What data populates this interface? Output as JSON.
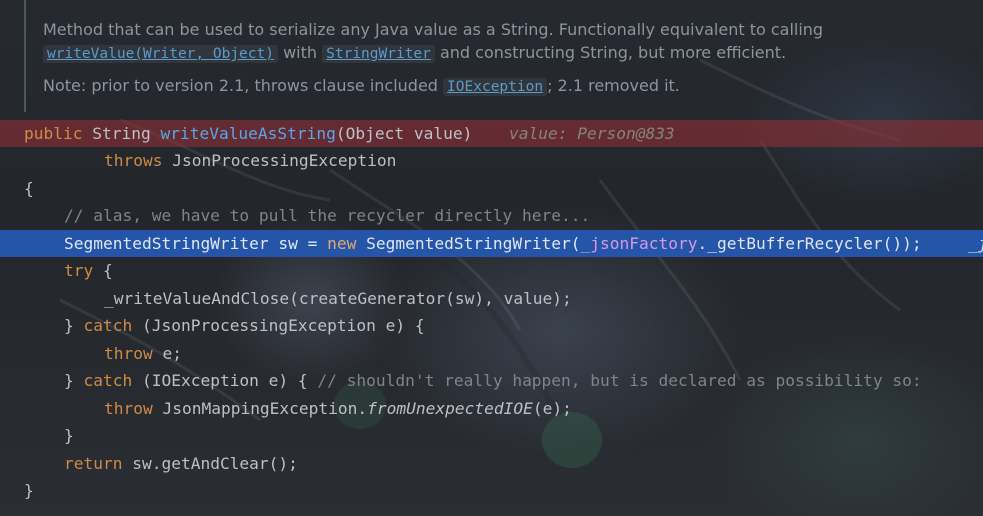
{
  "doc": {
    "line1": "Method that can be used to serialize any Java value as a String. Functionally equivalent to calling",
    "link_writevalue": "writeValue(Writer, Object)",
    "with": "with",
    "link_stringwriter": "StringWriter",
    "line2_rest": "and constructing String, but more efficient.",
    "note_prefix": "Note: prior to version 2.1, throws clause included",
    "link_ioexception": "IOException",
    "note_suffix": "; 2.1 removed it."
  },
  "code": {
    "l1": {
      "kw_public": "public",
      "type_string": "String",
      "method": "writeValueAsString",
      "params": "(Object value)",
      "inlay": "value: Person@833"
    },
    "l2": {
      "kw_throws": "throws",
      "exc": "JsonProcessingException"
    },
    "l3": {
      "brace": "{"
    },
    "l4": {
      "comment": "// alas, we have to pull the recycler directly here..."
    },
    "l5": {
      "decl": "SegmentedStringWriter sw = ",
      "kw_new": "new",
      "ctor": " SegmentedStringWriter(",
      "field": "_jsonFactory",
      "rest": "._getBufferRecycler());",
      "trail": "_j"
    },
    "l6": {
      "kw_try": "try",
      "rest": " {"
    },
    "l7": {
      "stmt": "_writeValueAndClose(createGenerator(sw), value);"
    },
    "l8": {
      "close": "} ",
      "kw_catch": "catch",
      "rest": " (JsonProcessingException e) {"
    },
    "l9": {
      "kw_throw": "throw",
      "rest": " e;"
    },
    "l10": {
      "close": "} ",
      "kw_catch": "catch",
      "rest": " (IOException e) { ",
      "comment": "// shouldn't really happen, but is declared as possibility so:"
    },
    "l11": {
      "kw_throw": "throw",
      "rest_a": " JsonMappingException.",
      "static_call": "fromUnexpectedIOE",
      "rest_b": "(e);"
    },
    "l12": {
      "brace": "}"
    },
    "l13": {
      "kw_return": "return",
      "rest": " sw.getAndClear();"
    },
    "l14": {
      "brace": "}"
    }
  }
}
